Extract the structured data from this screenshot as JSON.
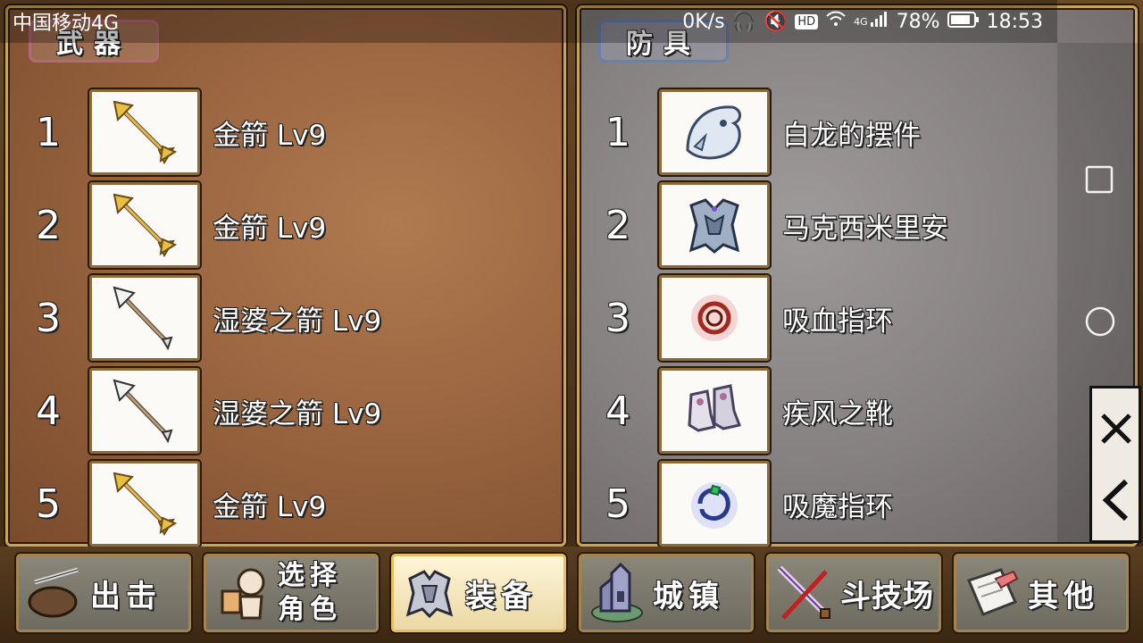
{
  "status_bar": {
    "carrier": "中国移动4G",
    "speed": "0K/s",
    "network": "4G",
    "battery": "78%",
    "time": "18:53"
  },
  "weapons": {
    "title": "武器",
    "items": [
      {
        "index": "1",
        "name": "金箭 Lv9",
        "icon": "golden-arrow-icon"
      },
      {
        "index": "2",
        "name": "金箭 Lv9",
        "icon": "golden-arrow-icon"
      },
      {
        "index": "3",
        "name": "湿婆之箭 Lv9",
        "icon": "silver-arrow-icon"
      },
      {
        "index": "4",
        "name": "湿婆之箭 Lv9",
        "icon": "silver-arrow-icon"
      },
      {
        "index": "5",
        "name": "金箭 Lv9",
        "icon": "golden-arrow-icon"
      }
    ]
  },
  "armor": {
    "title": "防具",
    "items": [
      {
        "index": "1",
        "name": "白龙的摆件",
        "icon": "white-dragon-icon"
      },
      {
        "index": "2",
        "name": "马克西米里安",
        "icon": "maximilian-armor-icon"
      },
      {
        "index": "3",
        "name": "吸血指环",
        "icon": "vampire-ring-icon"
      },
      {
        "index": "4",
        "name": "疾风之靴",
        "icon": "wind-boots-icon"
      },
      {
        "index": "5",
        "name": "吸魔指环",
        "icon": "mana-ring-icon"
      }
    ]
  },
  "tabs": [
    {
      "label": "出击",
      "icon": "sortie-icon",
      "active": false
    },
    {
      "label": "选择角色",
      "line1": "选择",
      "line2": "角色",
      "icon": "character-icon",
      "active": false
    },
    {
      "label": "装备",
      "icon": "equipment-icon",
      "active": true
    },
    {
      "label": "城镇",
      "icon": "town-icon",
      "active": false
    },
    {
      "label": "斗技场",
      "icon": "arena-icon",
      "active": false
    },
    {
      "label": "其他",
      "icon": "other-icon",
      "active": false
    }
  ],
  "colors": {
    "accent_gold": "#c9a45a",
    "active_tab": "#fff6d8",
    "weapons_panel": "#9a6540",
    "armor_panel": "#858080"
  }
}
